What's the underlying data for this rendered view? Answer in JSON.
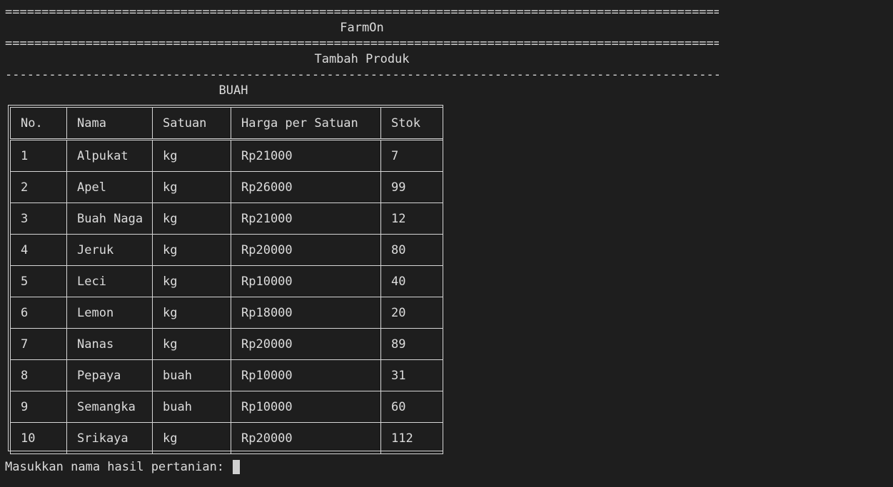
{
  "header": {
    "rule_double": "=======================================================================================================================",
    "app_title": "FarmOn",
    "page_title": "Tambah Produk",
    "rule_single": "-----------------------------------------------------------------------------------------------------------------------"
  },
  "category": "BUAH",
  "table": {
    "columns": [
      "No.",
      "Nama",
      "Satuan",
      "Harga per Satuan",
      "Stok"
    ],
    "rows": [
      [
        "1",
        "Alpukat",
        "kg",
        "Rp21000",
        "7"
      ],
      [
        "2",
        "Apel",
        "kg",
        "Rp26000",
        "99"
      ],
      [
        "3",
        "Buah Naga",
        "kg",
        "Rp21000",
        "12"
      ],
      [
        "4",
        "Jeruk",
        "kg",
        "Rp20000",
        "80"
      ],
      [
        "5",
        "Leci",
        "kg",
        "Rp10000",
        "40"
      ],
      [
        "6",
        "Lemon",
        "kg",
        "Rp18000",
        "20"
      ],
      [
        "7",
        "Nanas",
        "kg",
        "Rp20000",
        "89"
      ],
      [
        "8",
        "Pepaya",
        "buah",
        "Rp10000",
        "31"
      ],
      [
        "9",
        "Semangka",
        "buah",
        "Rp10000",
        "60"
      ],
      [
        "10",
        "Srikaya",
        "kg",
        "Rp20000",
        "112"
      ]
    ]
  },
  "prompt": {
    "label": "Masukkan nama hasil pertanian: "
  }
}
